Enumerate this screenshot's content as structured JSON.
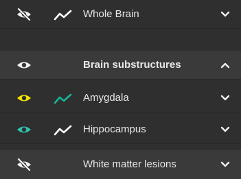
{
  "colors": {
    "background": "#2f2f2f",
    "row_alt": "#3a3a3a",
    "text": "#e8e8e8",
    "eye_default": "#f2f2f2",
    "eye_yellow": "#f4e400",
    "eye_teal": "#2ec4b0",
    "trend_white": "#ffffff",
    "trend_teal": "#18b59a"
  },
  "rows": [
    {
      "label": "Whole Brain",
      "visibility_icon": "eye-off-icon",
      "eye_color": "#f2f2f2",
      "trend_icon": "trend-line-icon",
      "trend_color": "#ffffff",
      "expand_icon": "chevron-down-icon",
      "bold": false
    },
    {
      "label": "Brain substructures",
      "visibility_icon": "eye-icon",
      "eye_color": "#f2f2f2",
      "trend_icon": null,
      "expand_icon": "chevron-up-icon",
      "bold": true
    },
    {
      "label": "Amygdala",
      "visibility_icon": "eye-icon",
      "eye_color": "#f4e400",
      "trend_icon": "trend-line-icon",
      "trend_color": "#18b59a",
      "expand_icon": "chevron-down-icon",
      "bold": false
    },
    {
      "label": "Hippocampus",
      "visibility_icon": "eye-icon",
      "eye_color": "#2ec4b0",
      "trend_icon": "trend-line-icon",
      "trend_color": "#ffffff",
      "expand_icon": "chevron-down-icon",
      "bold": false
    },
    {
      "label": "White matter lesions",
      "visibility_icon": "eye-off-icon",
      "eye_color": "#f2f2f2",
      "trend_icon": null,
      "expand_icon": "chevron-down-icon",
      "bold": false
    }
  ]
}
